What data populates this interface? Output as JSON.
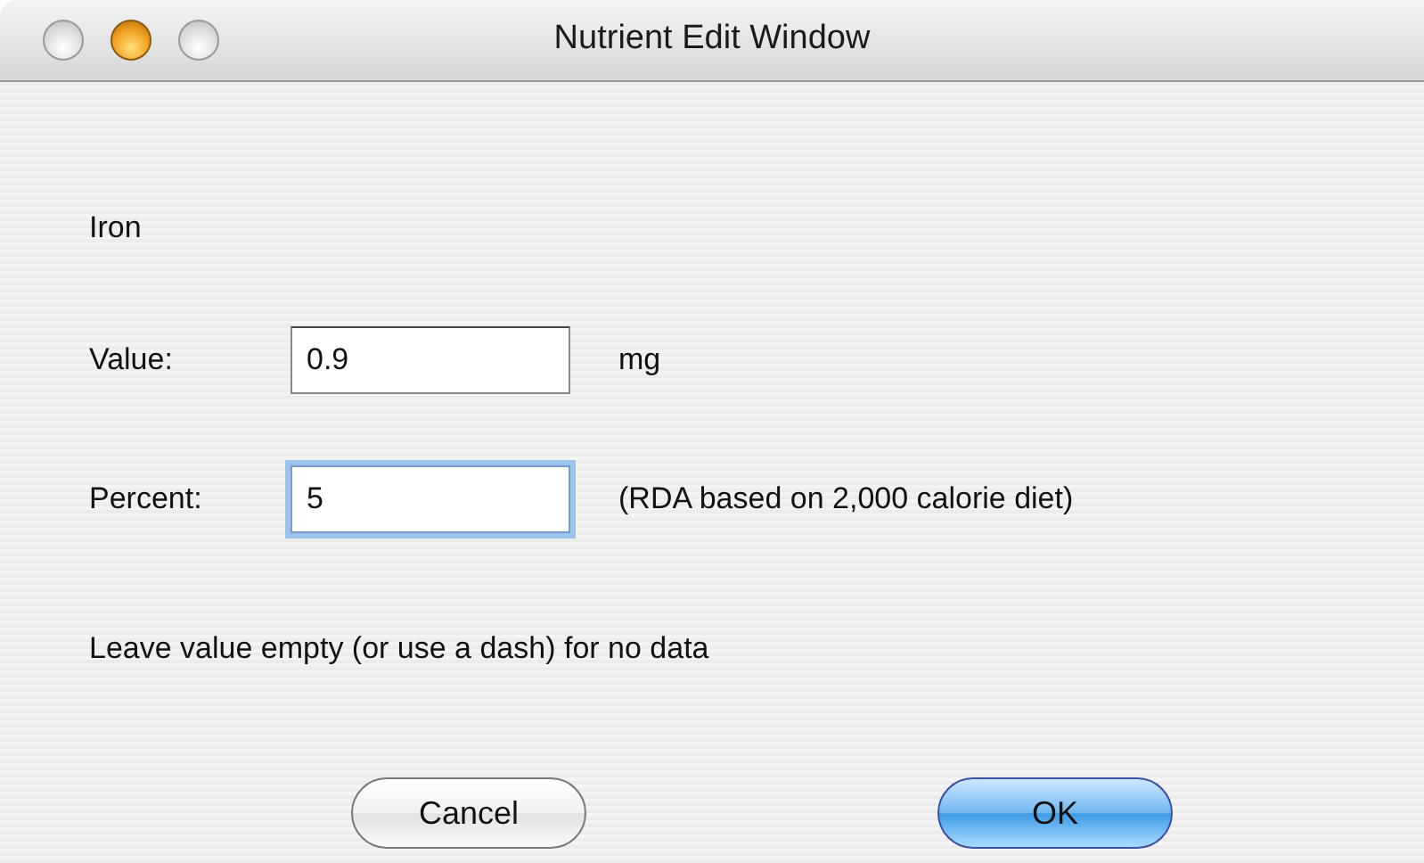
{
  "window": {
    "title": "Nutrient Edit Window",
    "title_buttons": [
      {
        "highlighted": false
      },
      {
        "highlighted": true
      },
      {
        "highlighted": false
      }
    ]
  },
  "nutrient": "Iron",
  "fields": [
    {
      "label": "Value:",
      "value": "0.9",
      "focused": false,
      "note": "mg"
    },
    {
      "label": "Percent:",
      "value": "5",
      "focused": true,
      "note": "(RDA based on 2,000 calorie diet)"
    }
  ],
  "hint": "Leave value empty (or use a dash) for no data",
  "buttons": [
    {
      "label": "Cancel",
      "default": false
    },
    {
      "label": "OK",
      "default": true
    }
  ]
}
